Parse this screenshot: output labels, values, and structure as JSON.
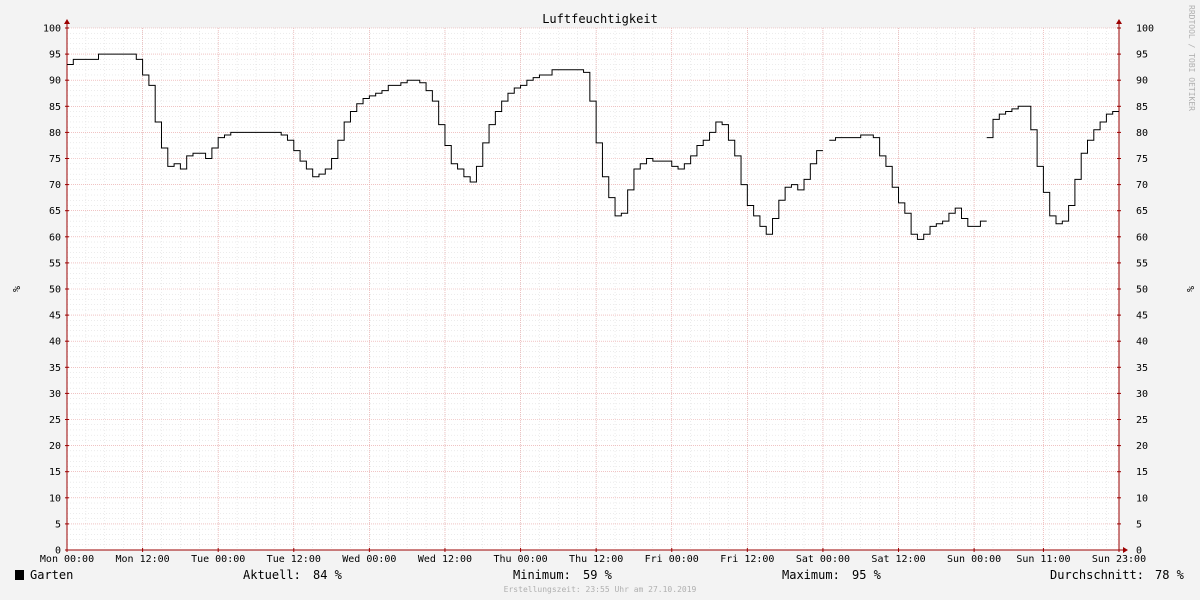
{
  "chart_data": {
    "type": "line",
    "title": "Luftfeuchtigkeit",
    "ylabel": "%",
    "xlabel": "",
    "ylim": [
      0,
      100
    ],
    "yticks": [
      0,
      5,
      10,
      15,
      20,
      25,
      30,
      35,
      40,
      45,
      50,
      55,
      60,
      65,
      70,
      75,
      80,
      85,
      90,
      95,
      100
    ],
    "xlim_hours": [
      0,
      167
    ],
    "xticks": [
      {
        "h": 0,
        "label": "Mon 00:00"
      },
      {
        "h": 12,
        "label": "Mon 12:00"
      },
      {
        "h": 24,
        "label": "Tue 00:00"
      },
      {
        "h": 36,
        "label": "Tue 12:00"
      },
      {
        "h": 48,
        "label": "Wed 00:00"
      },
      {
        "h": 60,
        "label": "Wed 12:00"
      },
      {
        "h": 72,
        "label": "Thu 00:00"
      },
      {
        "h": 84,
        "label": "Thu 12:00"
      },
      {
        "h": 96,
        "label": "Fri 00:00"
      },
      {
        "h": 108,
        "label": "Fri 12:00"
      },
      {
        "h": 120,
        "label": "Sat 00:00"
      },
      {
        "h": 132,
        "label": "Sat 12:00"
      },
      {
        "h": 144,
        "label": "Sun 00:00"
      },
      {
        "h": 155,
        "label": "Sun 11:00"
      },
      {
        "h": 167,
        "label": "Sun 23:00"
      }
    ],
    "grid": true,
    "series": [
      {
        "name": "Garten",
        "color": "#000000",
        "segments": [
          [
            [
              0,
              93
            ],
            [
              1,
              94
            ],
            [
              5,
              95
            ],
            [
              11,
              94
            ],
            [
              12,
              91
            ],
            [
              13,
              89
            ],
            [
              14,
              82
            ],
            [
              15,
              77
            ],
            [
              16,
              73.5
            ],
            [
              17,
              74
            ],
            [
              18,
              73
            ],
            [
              19,
              75.5
            ],
            [
              20,
              76
            ],
            [
              22,
              75
            ],
            [
              23,
              77
            ],
            [
              24,
              79
            ],
            [
              25,
              79.5
            ],
            [
              26,
              80
            ],
            [
              34,
              79.5
            ],
            [
              35,
              78.5
            ],
            [
              36,
              76.5
            ],
            [
              37,
              74.5
            ],
            [
              38,
              73
            ],
            [
              39,
              71.5
            ],
            [
              40,
              72
            ],
            [
              41,
              73
            ],
            [
              42,
              75
            ],
            [
              43,
              78.5
            ],
            [
              44,
              82
            ],
            [
              45,
              84
            ],
            [
              46,
              85.5
            ],
            [
              47,
              86.5
            ],
            [
              48,
              87
            ],
            [
              49,
              87.5
            ],
            [
              50,
              88
            ],
            [
              51,
              89
            ],
            [
              53,
              89.5
            ],
            [
              54,
              90
            ],
            [
              56,
              89.5
            ],
            [
              57,
              88
            ],
            [
              58,
              86
            ],
            [
              59,
              81.5
            ],
            [
              60,
              77.5
            ],
            [
              61,
              74
            ],
            [
              62,
              73
            ],
            [
              63,
              71.5
            ],
            [
              64,
              70.5
            ],
            [
              65,
              73.5
            ],
            [
              66,
              78
            ],
            [
              67,
              81.5
            ],
            [
              68,
              84
            ],
            [
              69,
              86
            ],
            [
              70,
              87.5
            ],
            [
              71,
              88.5
            ],
            [
              72,
              89
            ],
            [
              73,
              90
            ],
            [
              74,
              90.5
            ],
            [
              75,
              91
            ],
            [
              77,
              92
            ],
            [
              82,
              91.5
            ],
            [
              83,
              86
            ],
            [
              84,
              78
            ],
            [
              85,
              71.5
            ],
            [
              86,
              67.5
            ],
            [
              87,
              64
            ],
            [
              88,
              64.5
            ],
            [
              89,
              69
            ],
            [
              90,
              73
            ],
            [
              91,
              74
            ],
            [
              92,
              75
            ],
            [
              93,
              74.5
            ],
            [
              96,
              73.5
            ],
            [
              97,
              73
            ],
            [
              98,
              74
            ],
            [
              99,
              75.5
            ],
            [
              100,
              77.5
            ],
            [
              101,
              78.5
            ],
            [
              102,
              80
            ],
            [
              103,
              82
            ],
            [
              104,
              81.5
            ],
            [
              105,
              78.5
            ],
            [
              106,
              75.5
            ],
            [
              107,
              70
            ],
            [
              108,
              66
            ],
            [
              109,
              64
            ],
            [
              110,
              62
            ],
            [
              111,
              60.5
            ],
            [
              112,
              63.5
            ],
            [
              113,
              67
            ],
            [
              114,
              69.5
            ],
            [
              115,
              70
            ],
            [
              116,
              69
            ],
            [
              117,
              71
            ],
            [
              118,
              74
            ],
            [
              119,
              76.5
            ]
          ],
          [
            [
              121,
              78.5
            ],
            [
              122,
              79
            ],
            [
              126,
              79.5
            ],
            [
              128,
              79
            ],
            [
              129,
              75.5
            ],
            [
              130,
              73.5
            ],
            [
              131,
              69.5
            ],
            [
              132,
              66.5
            ],
            [
              133,
              64.5
            ],
            [
              134,
              60.5
            ],
            [
              135,
              59.5
            ],
            [
              136,
              60.5
            ],
            [
              137,
              62
            ],
            [
              138,
              62.5
            ],
            [
              139,
              63
            ],
            [
              140,
              64.5
            ],
            [
              141,
              65.5
            ],
            [
              142,
              63.5
            ],
            [
              143,
              62
            ],
            [
              145,
              63
            ]
          ],
          [
            [
              146,
              79
            ],
            [
              147,
              82.5
            ],
            [
              148,
              83.5
            ],
            [
              149,
              84
            ],
            [
              150,
              84.5
            ],
            [
              151,
              85
            ],
            [
              153,
              80.5
            ],
            [
              154,
              73.5
            ],
            [
              155,
              68.5
            ],
            [
              156,
              64
            ],
            [
              157,
              62.5
            ],
            [
              158,
              63
            ],
            [
              159,
              66
            ],
            [
              160,
              71
            ],
            [
              161,
              76
            ],
            [
              162,
              78.5
            ],
            [
              163,
              80.5
            ],
            [
              164,
              82
            ],
            [
              165,
              83.5
            ],
            [
              166,
              84
            ]
          ]
        ]
      }
    ]
  },
  "legend": {
    "series_name": "Garten",
    "aktuell_label": "Aktuell:",
    "aktuell_value": "84 %",
    "minimum_label": "Minimum:",
    "minimum_value": "59 %",
    "maximum_label": "Maximum:",
    "maximum_value": "95 %",
    "durchschnitt_label": "Durchschnitt:",
    "durchschnitt_value": "78 %"
  },
  "watermark": "RRDTOOL / TOBI OETIKER",
  "footer": "Erstellungszeit: 23:55 Uhr am 27.10.2019",
  "colors": {
    "background": "#f3f3f3",
    "canvas": "#ffffff",
    "major_grid": "#e8a0a0",
    "minor_grid": "#d8d8d8",
    "axis": "#9b0000",
    "line": "#000000"
  }
}
